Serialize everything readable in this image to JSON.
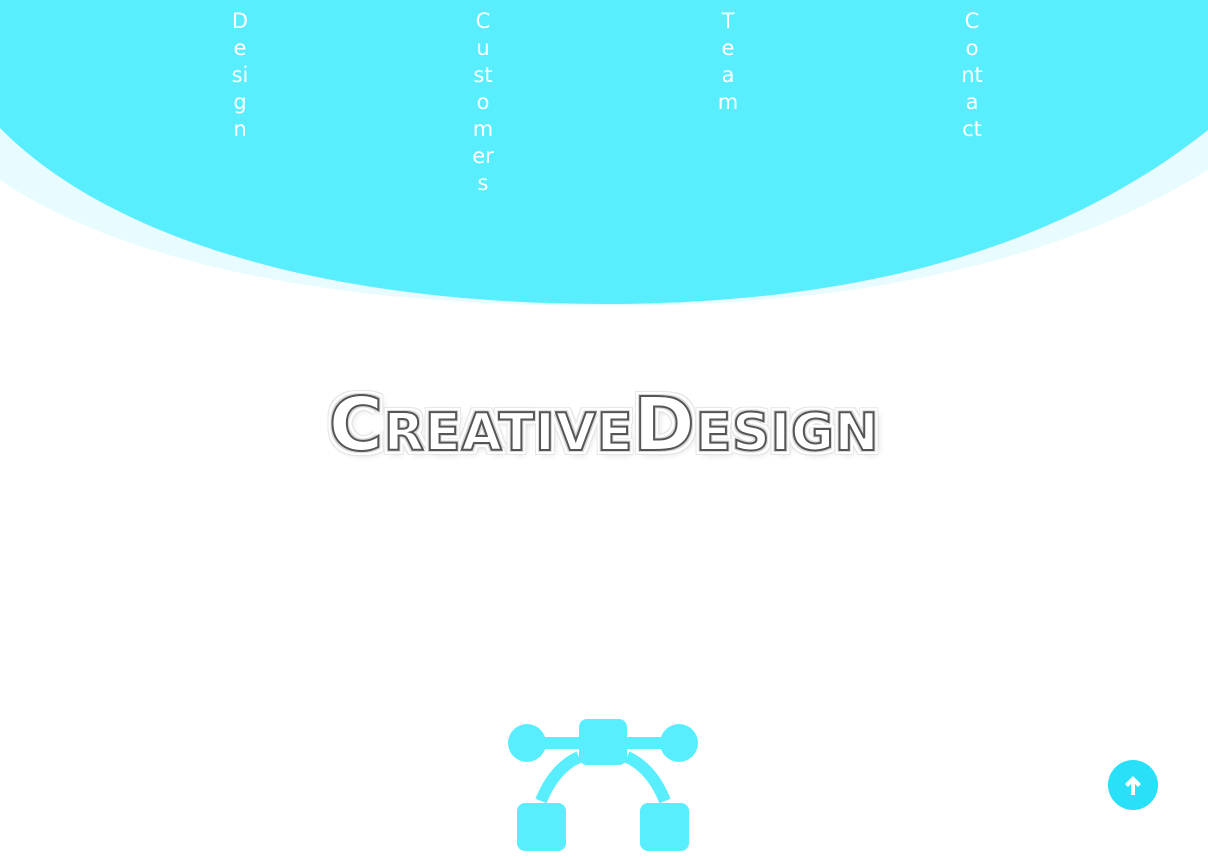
{
  "colors": {
    "accent": "#59eefe",
    "accent_light": "#e8fcff",
    "scroll_button": "#28e0f7",
    "nav_text": "#ffffff"
  },
  "nav": {
    "items": [
      {
        "label": "Design"
      },
      {
        "label": "Customers"
      },
      {
        "label": "Team"
      },
      {
        "label": "Contact"
      }
    ]
  },
  "hero": {
    "title": "CreativeDesign"
  },
  "icons": {
    "feature_icon": "vector-bezier-icon",
    "scroll_top_icon": "arrow-up-icon"
  }
}
